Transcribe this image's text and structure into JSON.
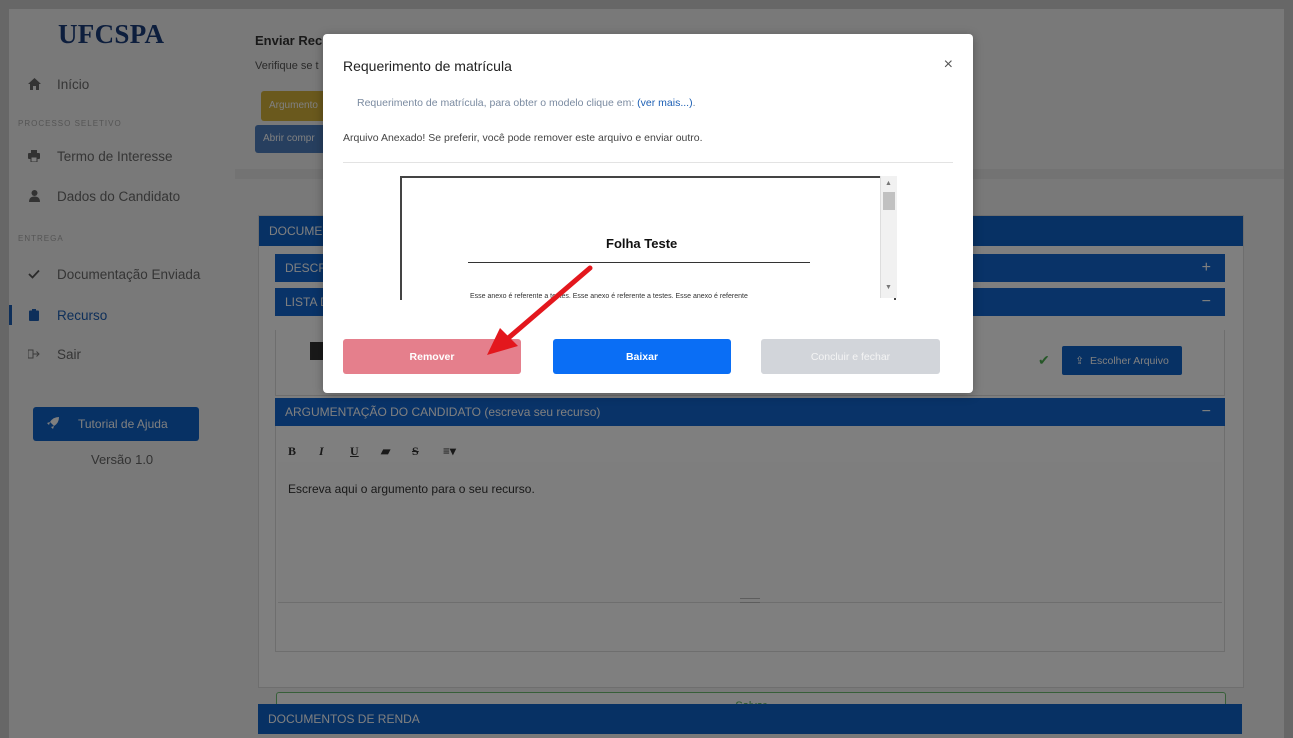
{
  "sidebar": {
    "logo": "UFCSPA",
    "items": [
      {
        "label": "Início"
      },
      {
        "label": "Termo de Interesse"
      },
      {
        "label": "Dados do Candidato"
      },
      {
        "label": "Documentação Enviada"
      },
      {
        "label": "Recurso"
      },
      {
        "label": "Sair"
      }
    ],
    "sections": [
      "PROCESSO SELETIVO",
      "ENTREGA"
    ],
    "tutorial_label": "Tutorial de Ajuda",
    "version": "Versão 1.0"
  },
  "header": {
    "title": "Enviar Recu",
    "subtitle": "Verifique se t",
    "btn_yellow": "Argumento",
    "btn_blue": "Abrir compr"
  },
  "card": {
    "header": "DOCUMEN",
    "bar_descr": "DESCR",
    "bar_descr_toggle": "+",
    "bar_lista": "LISTA D",
    "bar_lista_toggle": "−",
    "choose_file": "Escolher Arquivo",
    "argument_bar": "ARGUMENTAÇÃO DO CANDIDATO (escreva seu recurso)",
    "argument_toggle": "−",
    "toolbar": [
      "B",
      "I",
      "U",
      "▰",
      "S",
      "≡▾"
    ],
    "editor_text": "Escreva aqui o argumento para o seu recurso.",
    "save": "Salvar"
  },
  "renda_header": "DOCUMENTOS DE RENDA",
  "modal": {
    "title": "Requerimento de matrícula",
    "close": "×",
    "line1_prefix": "Requerimento de matrícula, para obter o modelo clique em: ",
    "line1_link": "(ver mais...)",
    "line1_suffix": ".",
    "line2": "Arquivo Anexado! Se preferir, você pode remover este arquivo e enviar outro.",
    "doc_title": "Folha Teste",
    "doc_text": "Esse anexo é referente a testes. Esse anexo é referente a testes. Esse anexo é referente",
    "btn_remove": "Remover",
    "btn_baixar": "Baixar",
    "btn_conclude": "Concluir e fechar"
  },
  "colors": {
    "primary": "#0f62c9",
    "danger_light": "#e57f8c",
    "download": "#0a6ef5",
    "disabled": "#d2d5da",
    "annotation_arrow": "#e3171d"
  }
}
